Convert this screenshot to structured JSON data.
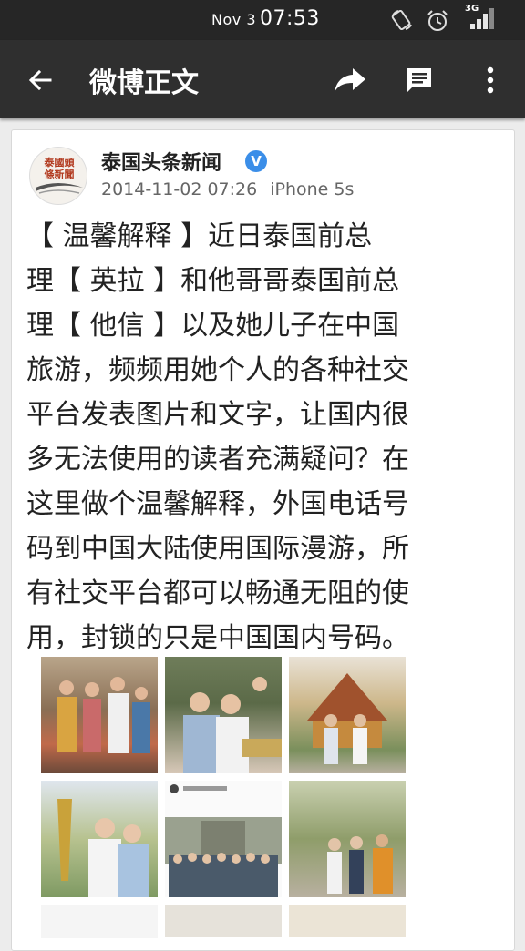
{
  "status_bar": {
    "date": "Nov 3",
    "time": "07:53",
    "network": "3G"
  },
  "app_bar": {
    "title": "微博正文",
    "icons": [
      "back-arrow-icon",
      "share-icon",
      "comment-icon",
      "more-vert-icon"
    ]
  },
  "post": {
    "avatar_text": "泰國頭條新聞",
    "username": "泰国头条新闻",
    "verified_mark": "V",
    "timestamp": "2014-11-02 07:26",
    "device": "iPhone 5s",
    "lines": [
      "【 温馨解释 】近日泰国前总",
      "理【 英拉 】和他哥哥泰国前总",
      "理【 他信 】以及她儿子在中国",
      "旅游，频频用她个人的各种社交",
      "平台发表图片和文字，让国内很",
      "多无法使用的读者充满疑问？在",
      "这里做个温馨解释，外国电话号",
      "码到中国大陆使用国际漫游，所",
      "有社交平台都可以畅通无阻的使",
      "用，封锁的只是中国国内号码。"
    ]
  },
  "colors": {
    "status_bar": "#262626",
    "app_bar": "#2f2f2f",
    "background": "#ececec",
    "verified": "#3b8ee8"
  }
}
